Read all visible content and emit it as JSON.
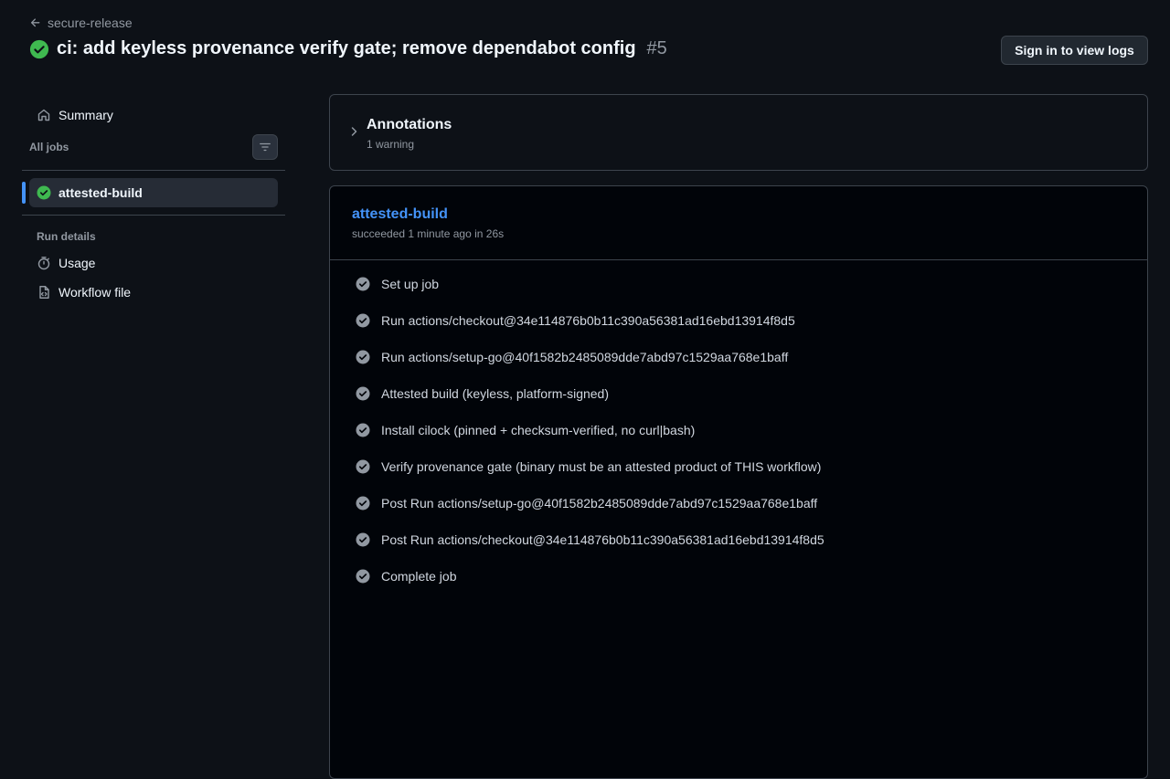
{
  "header": {
    "back_label": "secure-release",
    "title": "ci: add keyless provenance verify gate; remove dependabot config",
    "run_number": "#5",
    "signin_label": "Sign in to view logs"
  },
  "sidebar": {
    "summary_label": "Summary",
    "all_jobs_label": "All jobs",
    "jobs": [
      {
        "label": "attested-build",
        "status": "success"
      }
    ],
    "run_details_label": "Run details",
    "details": [
      {
        "label": "Usage",
        "icon": "stopwatch-icon"
      },
      {
        "label": "Workflow file",
        "icon": "file-code-icon"
      }
    ]
  },
  "annotations": {
    "title": "Annotations",
    "subtitle": "1 warning"
  },
  "job": {
    "name": "attested-build",
    "meta": "succeeded 1 minute ago in 26s",
    "steps": [
      {
        "label": "Set up job"
      },
      {
        "label": "Run actions/checkout@34e114876b0b11c390a56381ad16ebd13914f8d5"
      },
      {
        "label": "Run actions/setup-go@40f1582b2485089dde7abd97c1529aa768e1baff"
      },
      {
        "label": "Attested build (keyless, platform-signed)"
      },
      {
        "label": "Install cilock (pinned + checksum-verified, no curl|bash)"
      },
      {
        "label": "Verify provenance gate (binary must be an attested product of THIS workflow)"
      },
      {
        "label": "Post Run actions/setup-go@40f1582b2485089dde7abd97c1529aa768e1baff"
      },
      {
        "label": "Post Run actions/checkout@34e114876b0b11c390a56381ad16ebd13914f8d5"
      },
      {
        "label": "Complete job"
      }
    ]
  },
  "colors": {
    "success": "#3fb950",
    "link": "#4493f8",
    "step_check": "#9198a1"
  }
}
